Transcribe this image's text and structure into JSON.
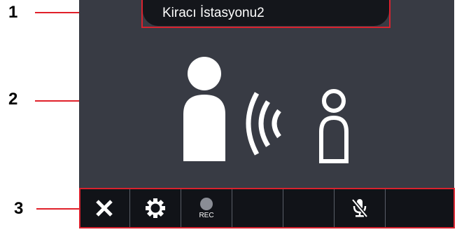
{
  "callouts": [
    {
      "number": "1"
    },
    {
      "number": "2"
    },
    {
      "number": "3"
    }
  ],
  "header": {
    "station_name": "Kiracı İstasyonu2"
  },
  "call_status": {
    "icon": "person-calling-person-icon"
  },
  "toolbar": {
    "buttons": [
      {
        "icon": "close-icon"
      },
      {
        "icon": "gear-icon"
      },
      {
        "icon": "record-icon",
        "label": "REC"
      },
      {
        "icon": "empty"
      },
      {
        "icon": "empty"
      },
      {
        "icon": "microphone-muted-icon"
      },
      {
        "icon": "empty"
      }
    ]
  },
  "colors": {
    "screen_bg": "#383b44",
    "toolbar_bg": "#111318",
    "callout_red": "#e0202a",
    "icon_white": "#ffffff"
  }
}
